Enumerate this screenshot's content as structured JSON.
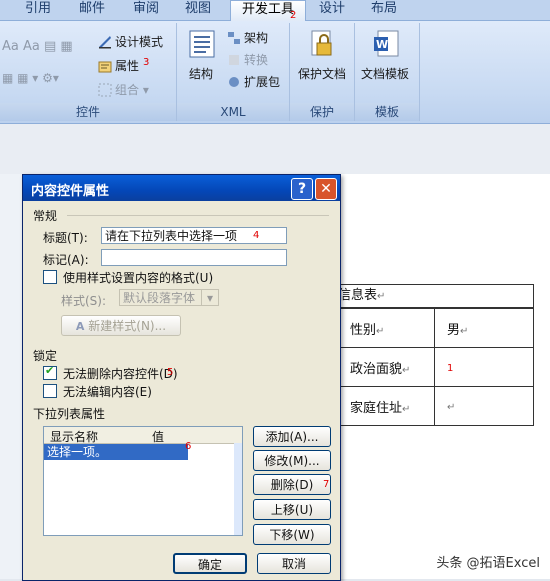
{
  "ribbon": {
    "tabs": [
      "引用",
      "邮件",
      "审阅",
      "视图",
      "开发工具",
      "设计",
      "布局"
    ],
    "active_tab": "开发工具",
    "controls_group": {
      "label": "控件",
      "design_mode": "设计模式",
      "properties": "属性",
      "group": "组合"
    },
    "xml_group": {
      "label": "XML",
      "structure": "结构",
      "schema": "架构",
      "transform": "转换",
      "expansion": "扩展包"
    },
    "protect_group": {
      "label": "保护",
      "protect_doc": "保护文档"
    },
    "template_group": {
      "label": "模板",
      "doc_template": "文档模板"
    }
  },
  "document": {
    "title_fragment": "信息表",
    "rows": [
      [
        "性别",
        "男"
      ],
      [
        "政治面貌",
        ""
      ],
      [
        "家庭住址",
        ""
      ]
    ],
    "paragraph_mark": "↵"
  },
  "dialog": {
    "title": "内容控件属性",
    "help": "?",
    "close": "✕",
    "general": {
      "heading": "常规",
      "title_label": "标题(T):",
      "title_value": "请在下拉列表中选择一项",
      "tag_label": "标记(A):",
      "tag_value": "",
      "use_style_label": "使用样式设置内容的格式(U)",
      "style_label": "样式(S):",
      "style_value": "默认段落字体",
      "new_style": "新建样式(N)..."
    },
    "lock": {
      "heading": "锁定",
      "no_delete_label": "无法删除内容控件(D)",
      "no_delete_checked": true,
      "no_edit_label": "无法编辑内容(E)",
      "no_edit_checked": false
    },
    "dropdown": {
      "heading": "下拉列表属性",
      "col_display": "显示名称",
      "col_value": "值",
      "items": [
        "选择一项。"
      ],
      "add": "添加(A)...",
      "modify": "修改(M)...",
      "remove": "删除(D)",
      "move_up": "上移(U)",
      "move_down": "下移(W)"
    },
    "ok": "确定",
    "cancel": "取消"
  },
  "annotations": [
    "1",
    "2",
    "3",
    "4",
    "5",
    "6",
    "7"
  ],
  "watermark": "头条 @拓语Excel"
}
